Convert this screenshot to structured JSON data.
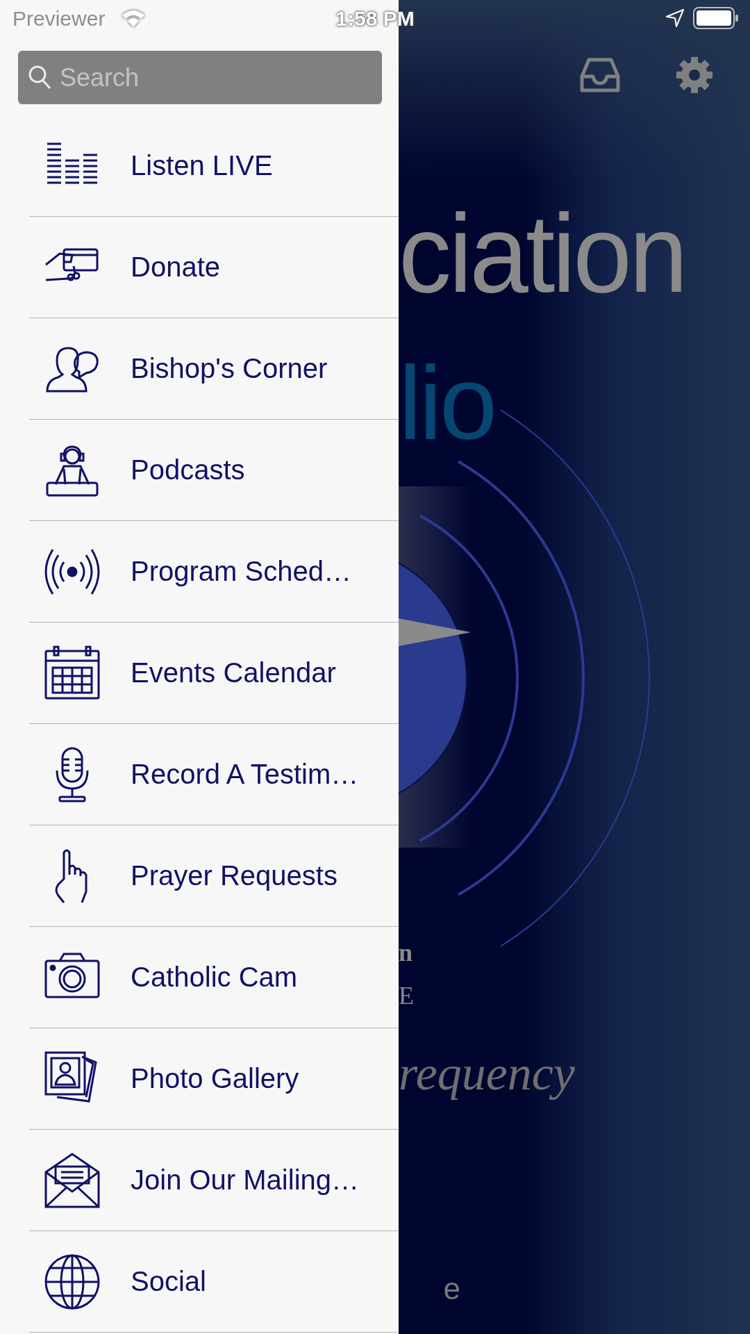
{
  "status_bar": {
    "carrier": "Previewer",
    "time": "1:58 PM"
  },
  "drawer": {
    "search": {
      "placeholder": "Search"
    },
    "items": [
      {
        "label": "Listen LIVE"
      },
      {
        "label": "Donate"
      },
      {
        "label": "Bishop's Corner"
      },
      {
        "label": "Podcasts"
      },
      {
        "label": "Program Sched…"
      },
      {
        "label": "Events Calendar"
      },
      {
        "label": "Record A Testim…"
      },
      {
        "label": "Prayer Requests"
      },
      {
        "label": "Catholic Cam"
      },
      {
        "label": "Photo Gallery"
      },
      {
        "label": "Join Our Mailing…"
      },
      {
        "label": "Social"
      }
    ]
  },
  "main": {
    "logo_texts": [
      "ciation",
      "lio",
      "n",
      "E",
      "requency"
    ],
    "button": "e"
  }
}
